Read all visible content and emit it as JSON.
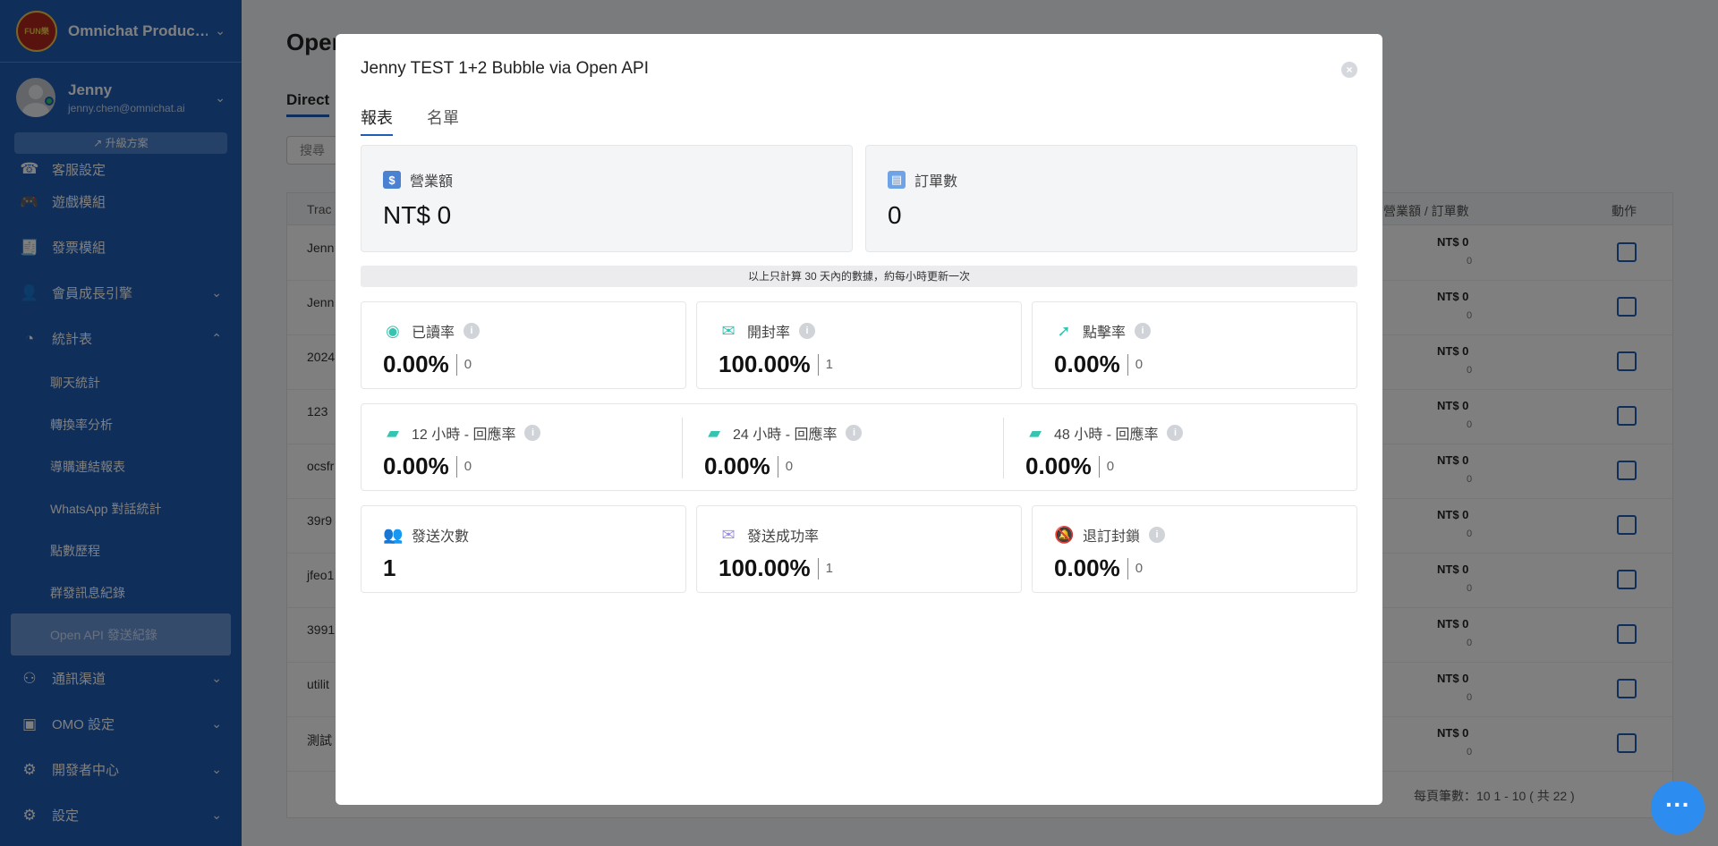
{
  "sidebar": {
    "org_name": "Omnichat Produc…",
    "org_logo_text": "FUN樂",
    "user_name": "Jenny",
    "user_email": "jenny.chen@omnichat.ai",
    "upgrade_label": "↗ 升級方案",
    "partial_item_label": "客服設定",
    "items": [
      {
        "label": "遊戲模組",
        "icon": "gamepad-icon",
        "glyph": "🎮",
        "chevron": ""
      },
      {
        "label": "發票模組",
        "icon": "invoice-icon",
        "glyph": "🧾",
        "chevron": ""
      },
      {
        "label": "會員成長引擎",
        "icon": "member-icon",
        "glyph": "👤",
        "chevron": "⌄"
      },
      {
        "label": "統計表",
        "icon": "pie-chart-icon",
        "glyph": "◔",
        "chevron": "⌃"
      }
    ],
    "subitems": [
      "聊天統計",
      "轉換率分析",
      "導購連結報表",
      "WhatsApp 對話統計",
      "點數歷程",
      "群發訊息紀錄",
      "Open API 發送紀錄"
    ],
    "bottom_items": [
      {
        "label": "通訊渠道",
        "icon": "channel-icon",
        "glyph": "⚇",
        "chevron": "⌄"
      },
      {
        "label": "OMO 設定",
        "icon": "omo-icon",
        "glyph": "▣",
        "chevron": "⌄"
      },
      {
        "label": "開發者中心",
        "icon": "developer-icon",
        "glyph": "⚙",
        "chevron": "⌄"
      },
      {
        "label": "設定",
        "icon": "settings-icon",
        "glyph": "⚙",
        "chevron": "⌄"
      }
    ]
  },
  "background": {
    "title": "Open",
    "tab": "Direct",
    "search_placeholder": "搜尋",
    "col_track": "Trac",
    "col_revenue": "營業額 / 訂單數",
    "col_action": "動作",
    "rows": [
      {
        "name": "Jenn API",
        "amount": "NT$ 0",
        "count": "0"
      },
      {
        "name": "Jenn",
        "amount": "NT$ 0",
        "count": "0"
      },
      {
        "name": "2024",
        "amount": "NT$ 0",
        "count": "0"
      },
      {
        "name": "123",
        "amount": "NT$ 0",
        "count": "0"
      },
      {
        "name": "ocsfr",
        "amount": "NT$ 0",
        "count": "0"
      },
      {
        "name": "39r9",
        "amount": "NT$ 0",
        "count": "0"
      },
      {
        "name": "jfeo1",
        "amount": "NT$ 0",
        "count": "0"
      },
      {
        "name": "3991",
        "amount": "NT$ 0",
        "count": "0"
      },
      {
        "name": "utilit",
        "amount": "NT$ 0",
        "count": "0"
      },
      {
        "name": "測試",
        "amount": "NT$ 0",
        "count": "0"
      }
    ],
    "pager": "每頁筆數：10    1 - 10 ( 共 22 )"
  },
  "modal": {
    "title": "Jenny TEST 1+2 Bubble via Open API",
    "close_glyph": "×",
    "tabs": [
      "報表",
      "名單"
    ],
    "revenue": {
      "label": "營業額",
      "value": "NT$ 0",
      "icon_glyph": "$"
    },
    "orders": {
      "label": "訂單數",
      "value": "0"
    },
    "note": "以上只計算 30 天內的數據，約每小時更新一次",
    "row1": [
      {
        "label": "已讀率",
        "icon": "eye-icon",
        "glyph": "◉",
        "color": "#35c4b0",
        "value": "0.00%",
        "count": "0"
      },
      {
        "label": "開封率",
        "icon": "open-envelope-icon",
        "glyph": "✉",
        "color": "#35c4b0",
        "value": "100.00%",
        "count": "1"
      },
      {
        "label": "點擊率",
        "icon": "click-icon",
        "glyph": "➚",
        "color": "#35c4b0",
        "value": "0.00%",
        "count": "0"
      }
    ],
    "row2": [
      {
        "label": "12 小時 - 回應率",
        "icon": "chat-bubble-icon",
        "glyph": "▰",
        "color": "#35c4b0",
        "value": "0.00%",
        "count": "0"
      },
      {
        "label": "24 小時 - 回應率",
        "icon": "chat-bubble-icon",
        "glyph": "▰",
        "color": "#35c4b0",
        "value": "0.00%",
        "count": "0"
      },
      {
        "label": "48 小時 - 回應率",
        "icon": "chat-bubble-icon",
        "glyph": "▰",
        "color": "#35c4b0",
        "value": "0.00%",
        "count": "0"
      }
    ],
    "row3": [
      {
        "label": "發送次數",
        "icon": "users-icon",
        "glyph": "👥",
        "color": "#9b8fe0",
        "value": "1",
        "count": ""
      },
      {
        "label": "發送成功率",
        "icon": "mail-icon",
        "glyph": "✉",
        "color": "#9b8fe0",
        "value": "100.00%",
        "count": "1"
      },
      {
        "label": "退訂封鎖",
        "icon": "bell-off-icon",
        "glyph": "🔕",
        "color": "#9b8fe0",
        "value": "0.00%",
        "count": "0"
      }
    ],
    "info_glyph": "i"
  },
  "colors": {
    "sidebar": "#1f5db5",
    "accent": "#35c4b0",
    "purple": "#9b8fe0"
  }
}
